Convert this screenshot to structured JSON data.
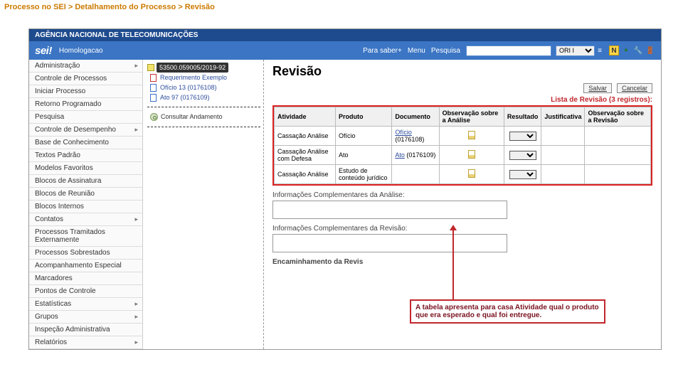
{
  "breadcrumb": "Processo no SEI > Detalhamento do Processo > Revisão",
  "agency": "AGÊNCIA NACIONAL DE TELECOMUNICAÇÕES",
  "logo": "sei!",
  "env": "Homologacao",
  "header": {
    "parasaber": "Para saber+",
    "menu": "Menu",
    "pesquisa": "Pesquisa",
    "select": "ORI I"
  },
  "icons": [
    "N",
    "bookmark",
    "wrench",
    "door"
  ],
  "menu": [
    {
      "label": "Administração",
      "arrow": true
    },
    {
      "label": "Controle de Processos",
      "arrow": false
    },
    {
      "label": "Iniciar Processo",
      "arrow": false
    },
    {
      "label": "Retorno Programado",
      "arrow": false
    },
    {
      "label": "Pesquisa",
      "arrow": false
    },
    {
      "label": "Controle de Desempenho",
      "arrow": true
    },
    {
      "label": "Base de Conhecimento",
      "arrow": false
    },
    {
      "label": "Textos Padrão",
      "arrow": false
    },
    {
      "label": "Modelos Favoritos",
      "arrow": false
    },
    {
      "label": "Blocos de Assinatura",
      "arrow": false
    },
    {
      "label": "Blocos de Reunião",
      "arrow": false
    },
    {
      "label": "Blocos Internos",
      "arrow": false
    },
    {
      "label": "Contatos",
      "arrow": true
    },
    {
      "label": "Processos Tramitados Externamente",
      "arrow": false
    },
    {
      "label": "Processos Sobrestados",
      "arrow": false
    },
    {
      "label": "Acompanhamento Especial",
      "arrow": false
    },
    {
      "label": "Marcadores",
      "arrow": false
    },
    {
      "label": "Pontos de Controle",
      "arrow": false
    },
    {
      "label": "Estatísticas",
      "arrow": true
    },
    {
      "label": "Grupos",
      "arrow": true
    },
    {
      "label": "Inspeção Administrativa",
      "arrow": false
    },
    {
      "label": "Relatórios",
      "arrow": true
    }
  ],
  "tree": {
    "root": "53500.059005/2019-92",
    "docs": [
      {
        "label": "Requerimento Exemplo",
        "ico": "red"
      },
      {
        "label": "Ofício 13 (0176108)",
        "ico": "blue"
      },
      {
        "label": "Ato 97 (0176109)",
        "ico": "blue"
      }
    ],
    "consultar": "Consultar Andamento"
  },
  "pageTitle": "Revisão",
  "buttons": {
    "salvar": "Salvar",
    "cancelar": "Cancelar"
  },
  "regCount": "Lista de Revisão (3 registros):",
  "chart_data": {
    "type": "table",
    "columns": [
      "Atividade",
      "Produto",
      "Documento",
      "Observação sobre a Análise",
      "Resultado",
      "Justificativa",
      "Observação sobre a Revisão"
    ],
    "rows": [
      {
        "atividade": "Cassação Análise",
        "produto": "Ofício",
        "documento": "Ofício (0176108)",
        "obs_analise": "icon",
        "resultado": "",
        "justificativa": "",
        "obs_revisao": ""
      },
      {
        "atividade": "Cassação Análise com Defesa",
        "produto": "Ato",
        "documento": "Ato (0176109)",
        "obs_analise": "icon",
        "resultado": "",
        "justificativa": "",
        "obs_revisao": ""
      },
      {
        "atividade": "Cassação Análise",
        "produto": "Estudo de conteúdo jurídico",
        "documento": "",
        "obs_analise": "icon",
        "resultado": "",
        "justificativa": "",
        "obs_revisao": ""
      }
    ]
  },
  "sections": {
    "compAnalise": "Informações Complementares da Análise:",
    "compRevisao": "Informações Complementares da Revisão:",
    "encaminhamento": "Encaminhamento da Revis"
  },
  "callout": "A tabela apresenta para casa Atividade qual o produto que era esperado e qual foi entregue."
}
